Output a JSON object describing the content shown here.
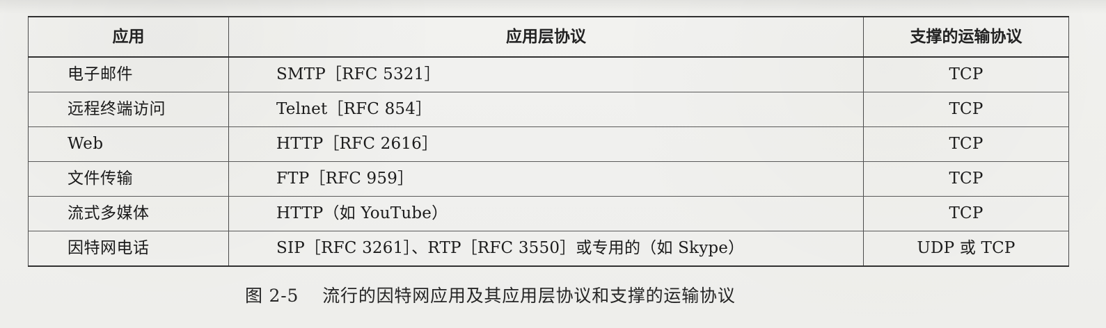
{
  "table": {
    "headers": [
      "应用",
      "应用层协议",
      "支撑的运输协议"
    ],
    "rows": [
      [
        "电子邮件",
        "SMTP［RFC 5321］",
        "TCP"
      ],
      [
        "远程终端访问",
        "Telnet［RFC 854］",
        "TCP"
      ],
      [
        "Web",
        "HTTP［RFC 2616］",
        "TCP"
      ],
      [
        "文件传输",
        "FTP［RFC 959］",
        "TCP"
      ],
      [
        "流式多媒体",
        "HTTP（如 YouTube）",
        "TCP"
      ],
      [
        "因特网电话",
        "SIP［RFC 3261］、RTP［RFC 3550］或专用的（如 Skype）",
        "UDP 或 TCP"
      ]
    ]
  },
  "caption": {
    "label": "图 2-5",
    "text": "流行的因特网应用及其应用层协议和支撑的运输协议"
  }
}
